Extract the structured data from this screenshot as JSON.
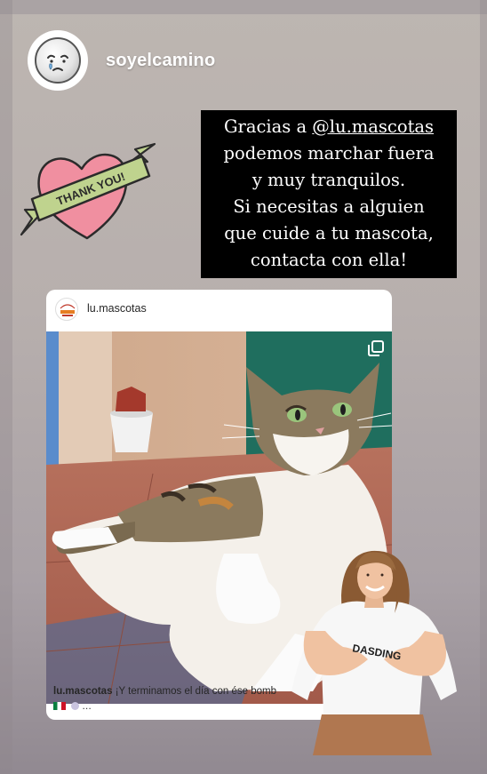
{
  "profile": {
    "username": "soyelcamino",
    "avatar_icon": "weeping-face-icon"
  },
  "sticker": {
    "text": "THANK YOU!",
    "heart_color": "#f08fa0",
    "ribbon_color": "#bfd38e"
  },
  "caption": {
    "line1_prefix": "Gracias a ",
    "line1_mention": "@lu.mascotas",
    "line2": "podemos marchar fuera",
    "line3": "y muy tranquilos.",
    "line4": "Si necesitas a alguien",
    "line5": "que cuide a tu mascota,",
    "line6": "contacta con ella!"
  },
  "shared_post": {
    "username": "lu.mascotas",
    "caption_user": "lu.mascotas",
    "caption_text": "¡Y terminamos el día con ése bomb",
    "caption_line2": "…",
    "multi_image_icon": "multiple-images-icon",
    "flag_icon": "mexico-flag-icon"
  },
  "person_sticker": {
    "shirt_text": "DASDING"
  }
}
